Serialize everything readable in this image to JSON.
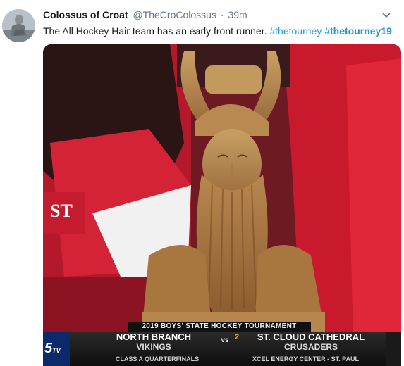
{
  "tweet": {
    "author_name": "Colossus of Croat",
    "author_handle": "@TheCroColossus",
    "separator": "·",
    "timestamp": "39m",
    "text": "The All Hockey Hair team has an early front runner.",
    "hashtags": [
      "#thetourney",
      "#thetourney19"
    ]
  },
  "media": {
    "scoreboard": {
      "title": "2019 BOYS' STATE HOCKEY TOURNAMENT",
      "network_logo": "5",
      "network_logo_suffix": "TV",
      "team1_name": "NORTH BRANCH",
      "team1_mascot": "VIKINGS",
      "vs": "vs",
      "team2_seed": "2",
      "team2_name": "ST. CLOUD CATHEDRAL",
      "team2_mascot": "CRUSADERS",
      "round": "CLASS A QUARTERFINALS",
      "venue": "XCEL ENERGY CENTER - ST. PAUL"
    }
  },
  "colors": {
    "link": "#1b95e0",
    "muted": "#657786",
    "jersey_red": "#c8102e"
  },
  "icons": {
    "caret": "chevron-down-icon"
  }
}
